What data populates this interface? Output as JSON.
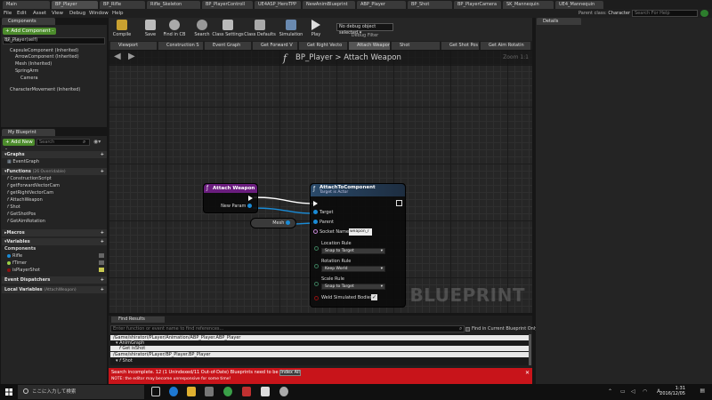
{
  "doc_tabs": [
    "Main",
    "BP_Player",
    "BP_Rifle",
    "Rifle_Skeleton",
    "BP_PlayerControll",
    "UE4ASP_HeroTPP",
    "NewAnimBlueprint",
    "ABP_Player",
    "BP_Shot",
    "BP_PlayerCamera",
    "SK_Mannequin",
    "UE4_Mannequin"
  ],
  "menu": [
    "File",
    "Edit",
    "Asset",
    "View",
    "Debug",
    "Window",
    "Help"
  ],
  "parent_class": {
    "label": "Parent class:",
    "value": "Character"
  },
  "search_help_placeholder": "Search For Help",
  "components": {
    "header": "Components",
    "add_button": "+ Add Component -",
    "search_placeholder": "Search",
    "items": [
      "BP_Player(self)",
      "CapsuleComponent (Inherited)",
      "ArrowComponent (Inherited)",
      "Mesh (Inherited)",
      "SpringArm",
      "Camera",
      "CharacterMovement (Inherited)"
    ]
  },
  "my_blueprint": {
    "header": "My Blueprint",
    "add_new": "+ Add New -",
    "search_placeholder": "Search",
    "graphs_label": "Graphs",
    "graphs": [
      "EventGraph"
    ],
    "functions_label": "Functions",
    "functions_overridable": "(26 Overridable)",
    "functions": [
      "ConstructionScript",
      "getForwardVectorCam",
      "getRightVectorCam",
      "AttachWeapon",
      "Shot",
      "GetShotPos",
      "GetAimRotation"
    ],
    "macros_label": "Macros",
    "variables_label": "Variables",
    "components_label": "Components",
    "variables": [
      "Rifle",
      "fTimer",
      "isPlayerShot"
    ],
    "event_dispatchers_label": "Event Dispatchers",
    "local_variables_label": "Local Variables",
    "local_variables_scope": "(AttachWeapon)"
  },
  "toolbar": {
    "buttons": [
      "Compile",
      "Save",
      "Find in CB",
      "Search",
      "Class Settings",
      "Class Defaults",
      "Simulation",
      "Play"
    ],
    "debug_selector": "No debug object selected",
    "debug_filter": "Debug Filter"
  },
  "graph_tabs": [
    "Viewport",
    "Construction S",
    "Event Graph",
    "Get Forward V",
    "Get Right Vecto",
    "Attach Weapon",
    "Shot",
    "Get Shot Pos",
    "Get Aim Rotatin"
  ],
  "graph": {
    "breadcrumb_root": "BP_Player",
    "breadcrumb_sep": ">",
    "breadcrumb_current": "Attach Weapon",
    "zoom": "Zoom 1:1",
    "watermark": "BLUEPRINT",
    "func_glyph": "f"
  },
  "nodes": {
    "entry": {
      "title": "Attach Weapon",
      "param": "New Param"
    },
    "mesh": {
      "label": "Mesh"
    },
    "attach": {
      "title": "AttachToComponent",
      "subtitle": "Target is Actor",
      "target": "Target",
      "parent": "Parent",
      "socket_label": "Socket Name",
      "socket_value": "weapon_r",
      "location_rule_label": "Location Rule",
      "location_rule": "Snap to Target",
      "rotation_rule_label": "Rotation Rule",
      "rotation_rule": "Keep World",
      "scale_rule_label": "Scale Rule",
      "scale_rule": "Snap to Target",
      "weld_label": "Weld Simulated Bodies"
    }
  },
  "find_results": {
    "tab": "Find Results",
    "placeholder": "Enter function or event name to find references...",
    "find_current": "Find in Current Blueprint Only",
    "results": [
      "/Game/shiratori/PLayer/Animation/ABP_Player.ABP_Player",
      "AnimGraph",
      "Get isShot",
      "/Game/shiratori/PLayer/BP_Player.BP_Player",
      "Shot"
    ]
  },
  "error_bar": {
    "line1": "Search incomplete. 12 (1 Unindexed/11 Out-of-Date) Blueprints need to be indexed!",
    "button": "Index All",
    "line2": "NOTE: the editor may become unresponsive for some time!",
    "close": "✕"
  },
  "details": {
    "header": "Details"
  },
  "taskbar": {
    "search": "ここに入力して検索",
    "time": "1:31",
    "date": "2016/12/05",
    "ime": "A"
  },
  "colors": {
    "entry_header": "#6a1d7e",
    "call_header": "#2a4a6a",
    "pin_blue": "#1a8bd6",
    "error_red": "#c8141a",
    "add_green": "#4c8c2c"
  }
}
